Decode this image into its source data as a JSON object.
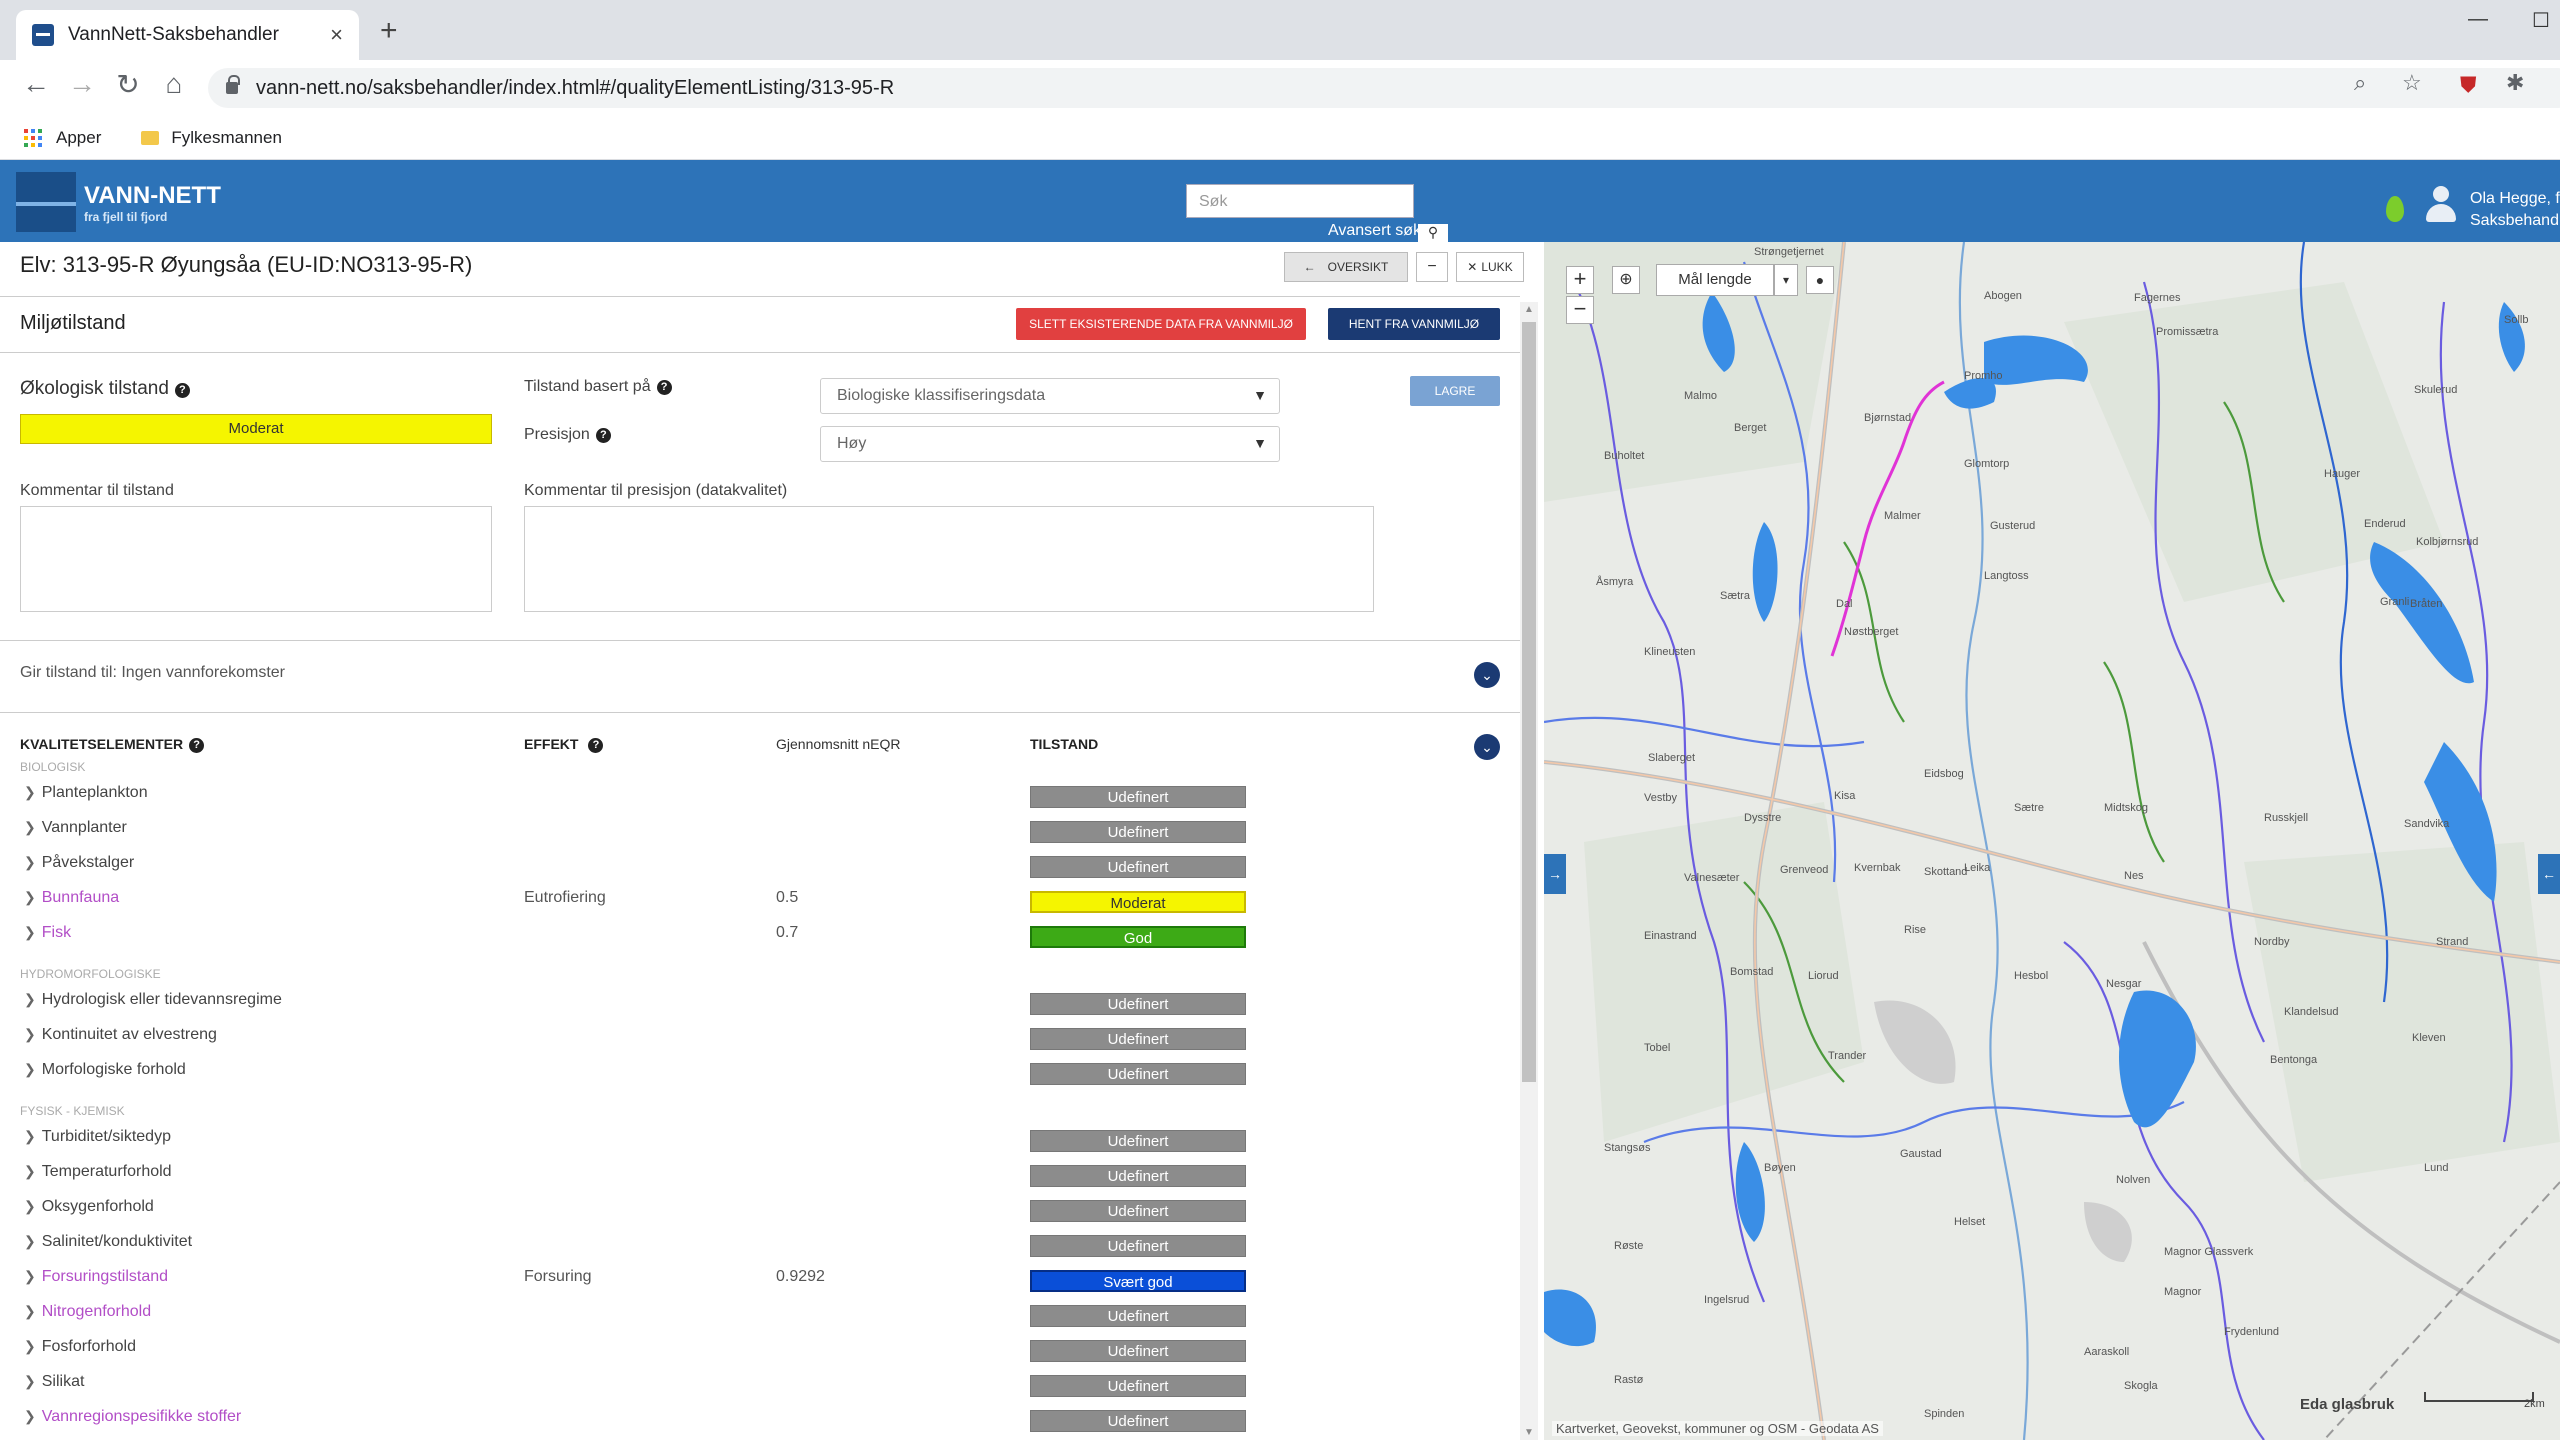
{
  "browser": {
    "tab_title": "VannNett-Saksbehandler",
    "url": "vann-nett.no/saksbehandler/index.html#/qualityElementListing/313-95-R",
    "bookmarks": [
      "Apper",
      "Fylkesmannen"
    ]
  },
  "header": {
    "logo_title": "VANN-NETT",
    "logo_sub": "fra fjell til fjord",
    "search_placeholder": "Søk",
    "advanced_search": "Avansert søk",
    "user_line1": "Ola Hegge, f",
    "user_line2": "Saksbehandl"
  },
  "record": {
    "title": "Elv: 313-95-R Øyungsåa (EU-ID:NO313-95-R)",
    "btn_overview": "OVERSIKT",
    "btn_minus": "−",
    "btn_close": "LUKK"
  },
  "miljo": {
    "title": "Miljøtilstand",
    "btn_delete": "SLETT EKSISTERENDE DATA FRA VANNMILJØ",
    "btn_fetch": "HENT FRA VANNMILJØ",
    "eco_label": "Økologisk tilstand",
    "eco_value": "Moderat",
    "basis_label": "Tilstand basert på",
    "basis_value": "Biologiske klassifiseringsdata",
    "precision_label": "Presisjon",
    "precision_value": "Høy",
    "btn_save": "LAGRE",
    "comment_state": "Kommentar til tilstand",
    "comment_precision": "Kommentar til presisjon (datakvalitet)",
    "gives_state": "Gir tilstand til: Ingen vannforekomster"
  },
  "quality": {
    "col_element": "KVALITETSELEMENTER",
    "col_effect": "EFFEKT",
    "col_neqr": "Gjennomsnitt nEQR",
    "col_state": "TILSTAND",
    "groups": [
      {
        "label": "BIOLOGISK",
        "rows": [
          {
            "name": "Planteplankton",
            "effect": "",
            "neqr": "",
            "state": "Udefinert",
            "link": false
          },
          {
            "name": "Vannplanter",
            "effect": "",
            "neqr": "",
            "state": "Udefinert",
            "link": false
          },
          {
            "name": "Påvekstalger",
            "effect": "",
            "neqr": "",
            "state": "Udefinert",
            "link": false
          },
          {
            "name": "Bunnfauna",
            "effect": "Eutrofiering",
            "neqr": "0.5",
            "state": "Moderat",
            "link": true
          },
          {
            "name": "Fisk",
            "effect": "",
            "neqr": "0.7",
            "state": "God",
            "link": true
          }
        ]
      },
      {
        "label": "HYDROMORFOLOGISKE",
        "rows": [
          {
            "name": "Hydrologisk eller tidevannsregime",
            "effect": "",
            "neqr": "",
            "state": "Udefinert",
            "link": false
          },
          {
            "name": "Kontinuitet av elvestreng",
            "effect": "",
            "neqr": "",
            "state": "Udefinert",
            "link": false
          },
          {
            "name": "Morfologiske forhold",
            "effect": "",
            "neqr": "",
            "state": "Udefinert",
            "link": false
          }
        ]
      },
      {
        "label": "FYSISK - KJEMISK",
        "rows": [
          {
            "name": "Turbiditet/siktedyp",
            "effect": "",
            "neqr": "",
            "state": "Udefinert",
            "link": false
          },
          {
            "name": "Temperaturforhold",
            "effect": "",
            "neqr": "",
            "state": "Udefinert",
            "link": false
          },
          {
            "name": "Oksygenforhold",
            "effect": "",
            "neqr": "",
            "state": "Udefinert",
            "link": false
          },
          {
            "name": "Salinitet/konduktivitet",
            "effect": "",
            "neqr": "",
            "state": "Udefinert",
            "link": false
          },
          {
            "name": "Forsuringstilstand",
            "effect": "Forsuring",
            "neqr": "0.9292",
            "state": "Svært god",
            "link": true
          },
          {
            "name": "Nitrogenforhold",
            "effect": "",
            "neqr": "",
            "state": "Udefinert",
            "link": true
          },
          {
            "name": "Fosforforhold",
            "effect": "",
            "neqr": "",
            "state": "Udefinert",
            "link": false
          },
          {
            "name": "Silikat",
            "effect": "",
            "neqr": "",
            "state": "Udefinert",
            "link": false
          },
          {
            "name": "Vannregionspesifikke stoffer",
            "effect": "",
            "neqr": "",
            "state": "Udefinert",
            "link": true
          }
        ]
      }
    ]
  },
  "state_colors": {
    "Udefinert": "#8c8c8c",
    "Moderat": "#f5f500",
    "God": "#3daa16",
    "Svært god": "#0a4fd8"
  },
  "map": {
    "measure_label": "Mål lengde",
    "attribution": "Kartverket, Geovekst, kommuner og OSM - Geodata AS",
    "scale_label": "2km",
    "place_names": [
      "Strøngetjernet",
      "Abogen",
      "Fagernes",
      "Sollb",
      "Promissætra",
      "Promho",
      "Skulerud",
      "Malmo",
      "Berget",
      "Bjørnstad",
      "Hauger",
      "Buholtet",
      "Glomtorp",
      "Gusterud",
      "Enderud",
      "Kolbjørnsrud",
      "Malmer",
      "Langtoss",
      "Åsmyra",
      "Sætra",
      "Dal",
      "Nøstberget",
      "Granli",
      "Klineusten",
      "Bråten",
      "Slaberget",
      "Kisa",
      "Eidsbog",
      "Vestby",
      "Dysstre",
      "Sætre",
      "Midtskog",
      "Russkjell",
      "Sandvika",
      "Valnesæter",
      "Kvernbak",
      "Leika",
      "Grenveod",
      "Skottand",
      "Nes",
      "Nordby",
      "Strand",
      "Rise",
      "Hesbol",
      "Nesgar",
      "Einastrand",
      "Bomstad",
      "Liorud",
      "Kleven",
      "Klandelsud",
      "Tobel",
      "Trander",
      "Bentonga",
      "Stangsøs",
      "Gaustad",
      "Nolven",
      "Bøyen",
      "Helset",
      "Lund",
      "Magnor Glassverk",
      "Magnor",
      "Røste",
      "Aaraskoll",
      "Frydenlund",
      "Ingelsrud",
      "Skogla",
      "Rastø",
      "Spinden",
      "Eda glasbruk"
    ]
  }
}
